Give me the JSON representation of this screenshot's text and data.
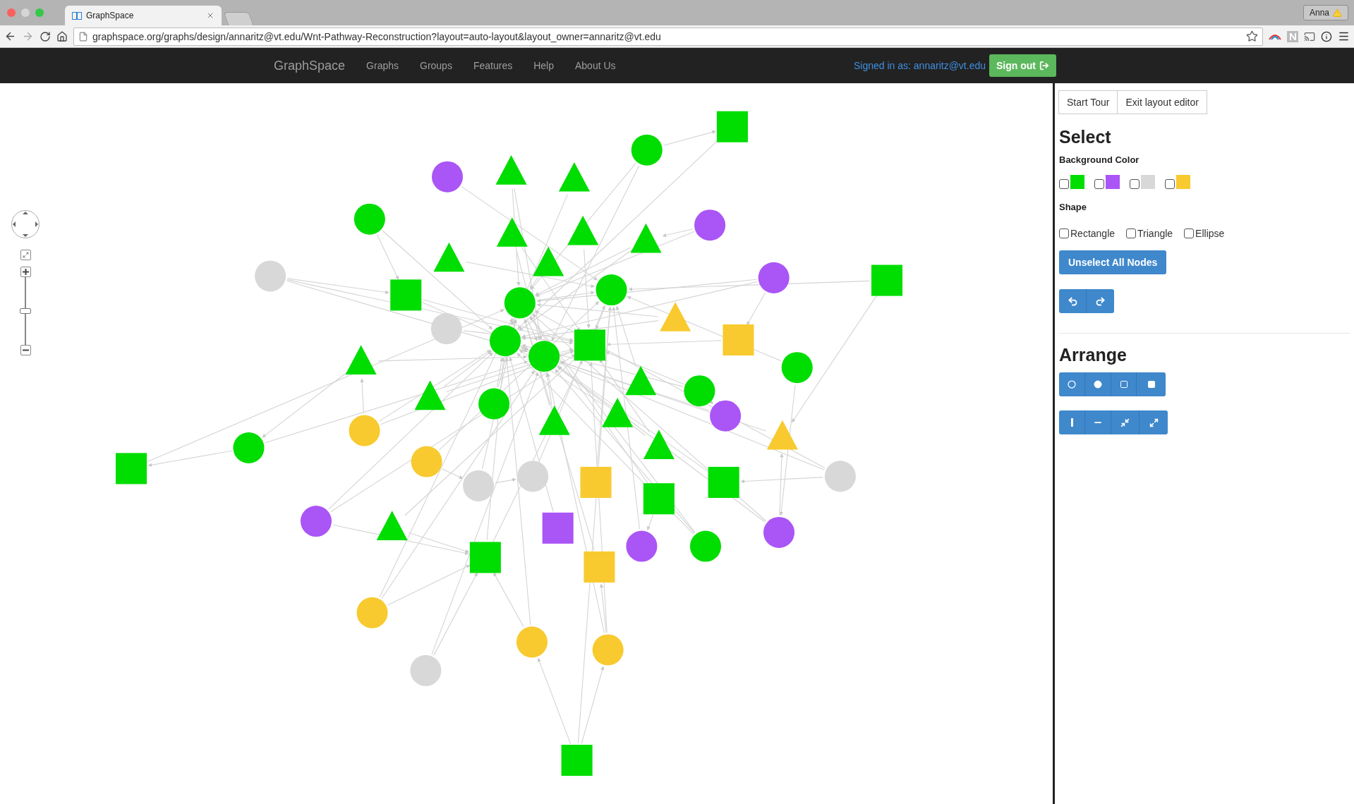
{
  "browser": {
    "tabs": [
      {
        "title": "GraphSpace",
        "selected": true
      }
    ],
    "profile": "Anna",
    "url": "graphspace.org/graphs/design/annaritz@vt.edu/Wnt-Pathway-Reconstruction?layout=auto-layout&layout_owner=annaritz@vt.edu"
  },
  "navbar": {
    "brand": "GraphSpace",
    "links": [
      "Graphs",
      "Groups",
      "Features",
      "Help",
      "About Us"
    ],
    "signed_in": "Signed in as: annaritz@vt.edu",
    "sign_out": "Sign out"
  },
  "zoom_slider": {
    "level": 0.5
  },
  "panel": {
    "top_buttons": [
      "Start Tour",
      "Exit layout editor"
    ],
    "select_title": "Select",
    "color_label": "Background Color",
    "colors": [
      {
        "color": "#00dd00",
        "checked": false
      },
      {
        "color": "#aa55f5",
        "checked": false
      },
      {
        "color": "#d8d8d8",
        "checked": false
      },
      {
        "color": "#f8ca2f",
        "checked": false
      }
    ],
    "shape_label": "Shape",
    "shapes": [
      {
        "label": "Rectangle",
        "checked": false
      },
      {
        "label": "Triangle",
        "checked": false
      },
      {
        "label": "Ellipse",
        "checked": false
      }
    ],
    "unselect": "Unselect All Nodes",
    "arrange_title": "Arrange"
  }
}
